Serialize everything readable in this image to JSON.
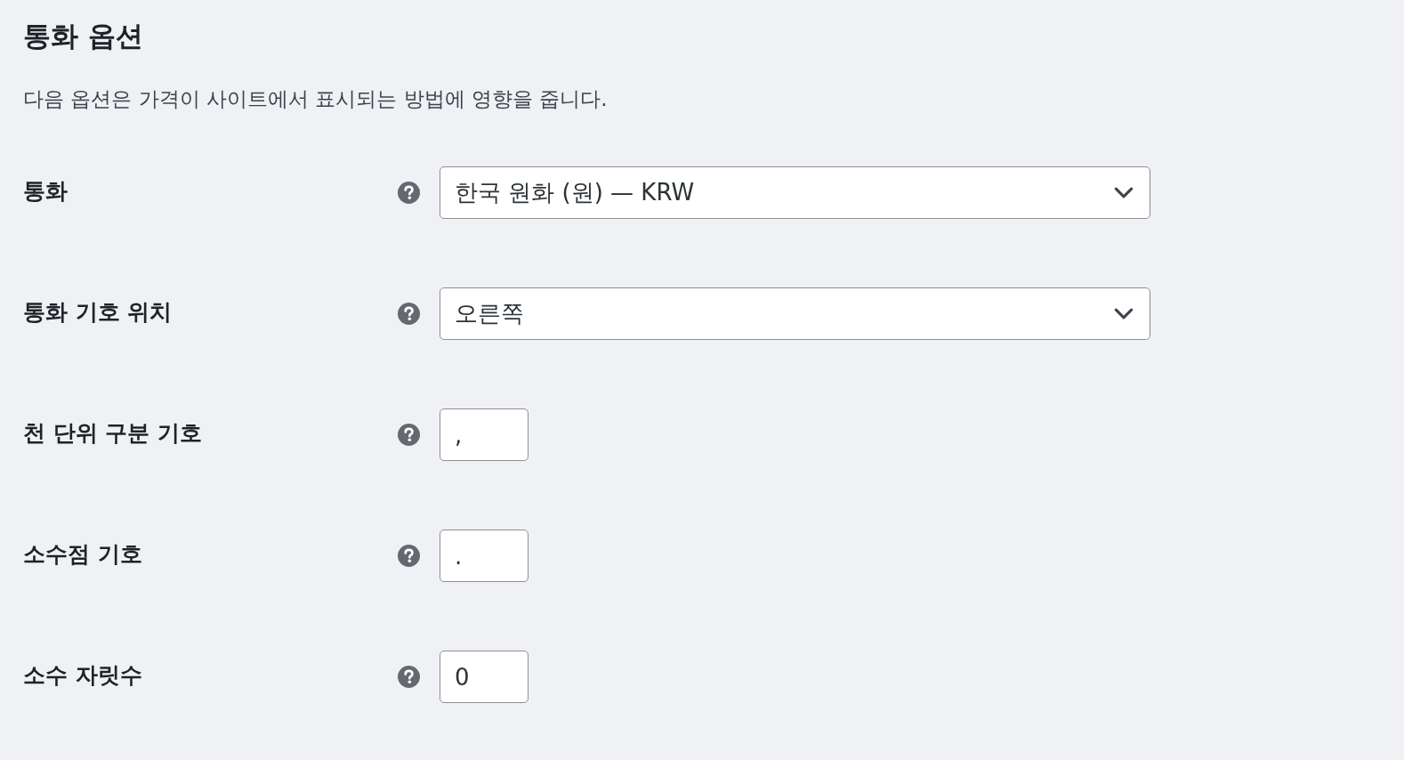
{
  "heading": "통화 옵션",
  "description": "다음 옵션은 가격이 사이트에서 표시되는 방법에 영향을 줍니다.",
  "fields": [
    {
      "label": "통화",
      "kind": "select",
      "value": "한국 원화 (원) — KRW"
    },
    {
      "label": "통화 기호 위치",
      "kind": "select",
      "value": "오른쪽"
    },
    {
      "label": "천 단위 구분 기호",
      "kind": "text",
      "value": ","
    },
    {
      "label": "소수점 기호",
      "kind": "text",
      "value": "."
    },
    {
      "label": "소수 자릿수",
      "kind": "text",
      "value": "0"
    }
  ]
}
